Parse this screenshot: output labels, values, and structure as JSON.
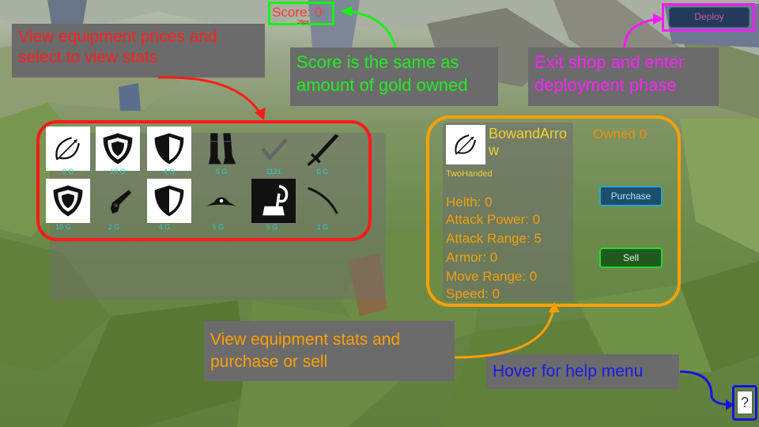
{
  "score": {
    "text": "Score: 0",
    "sub": "26px"
  },
  "deploy_button": "Deploy",
  "callouts": {
    "view_prices": "View equipment prices and select to view stats",
    "score_gold": "Score is the same as amount of gold owned",
    "exit_shop": "Exit shop and enter deployment phase",
    "view_stats": "View equipment stats and purchase or sell",
    "help_hover": "Hover for help menu"
  },
  "equipment": [
    {
      "name": "bow-and-arrow",
      "icon": "bow-arrow-icon",
      "price": "0 G"
    },
    {
      "name": "large-shield",
      "icon": "large-shield-icon",
      "price": "10 G"
    },
    {
      "name": "half-shield",
      "icon": "half-shield-icon",
      "price": "4 G"
    },
    {
      "name": "boots",
      "icon": "boots-icon",
      "price": "5 G"
    },
    {
      "name": "checkmark",
      "icon": "checkmark-icon",
      "price": "1121"
    },
    {
      "name": "sword",
      "icon": "sword-icon",
      "price": "0 G"
    },
    {
      "name": "large-shield-2",
      "icon": "large-shield-icon",
      "price": "10 G"
    },
    {
      "name": "pistol",
      "icon": "pistol-icon",
      "price": "2 G"
    },
    {
      "name": "half-shield-2",
      "icon": "half-shield-icon",
      "price": "4 G"
    },
    {
      "name": "pirate-hat",
      "icon": "pirate-hat-icon",
      "price": "5 G"
    },
    {
      "name": "hook",
      "icon": "hook-icon",
      "price": "5 G"
    },
    {
      "name": "sabre",
      "icon": "sabre-icon",
      "price": "1 G"
    }
  ],
  "details": {
    "name": "BowandArrow",
    "name_line1": "BowandArro",
    "name_line2": "w",
    "type": "TwoHanded",
    "owned": "Owned 0",
    "stats": [
      "Helth: 0",
      "Attack Power: 0",
      "Attack Range: 5",
      "Armor: 0",
      "Move Range: 0",
      "Speed: 0"
    ],
    "purchase_label": "Purchase",
    "sell_label": "Sell"
  },
  "help_icon": "?",
  "colors": {
    "red": "#ff1a1a",
    "green": "#19f019",
    "magenta": "#ff19ff",
    "orange": "#ffa000",
    "blue": "#1414e6",
    "teal_text": "#35c8cc",
    "panel_gray": "#6b6b6b"
  }
}
